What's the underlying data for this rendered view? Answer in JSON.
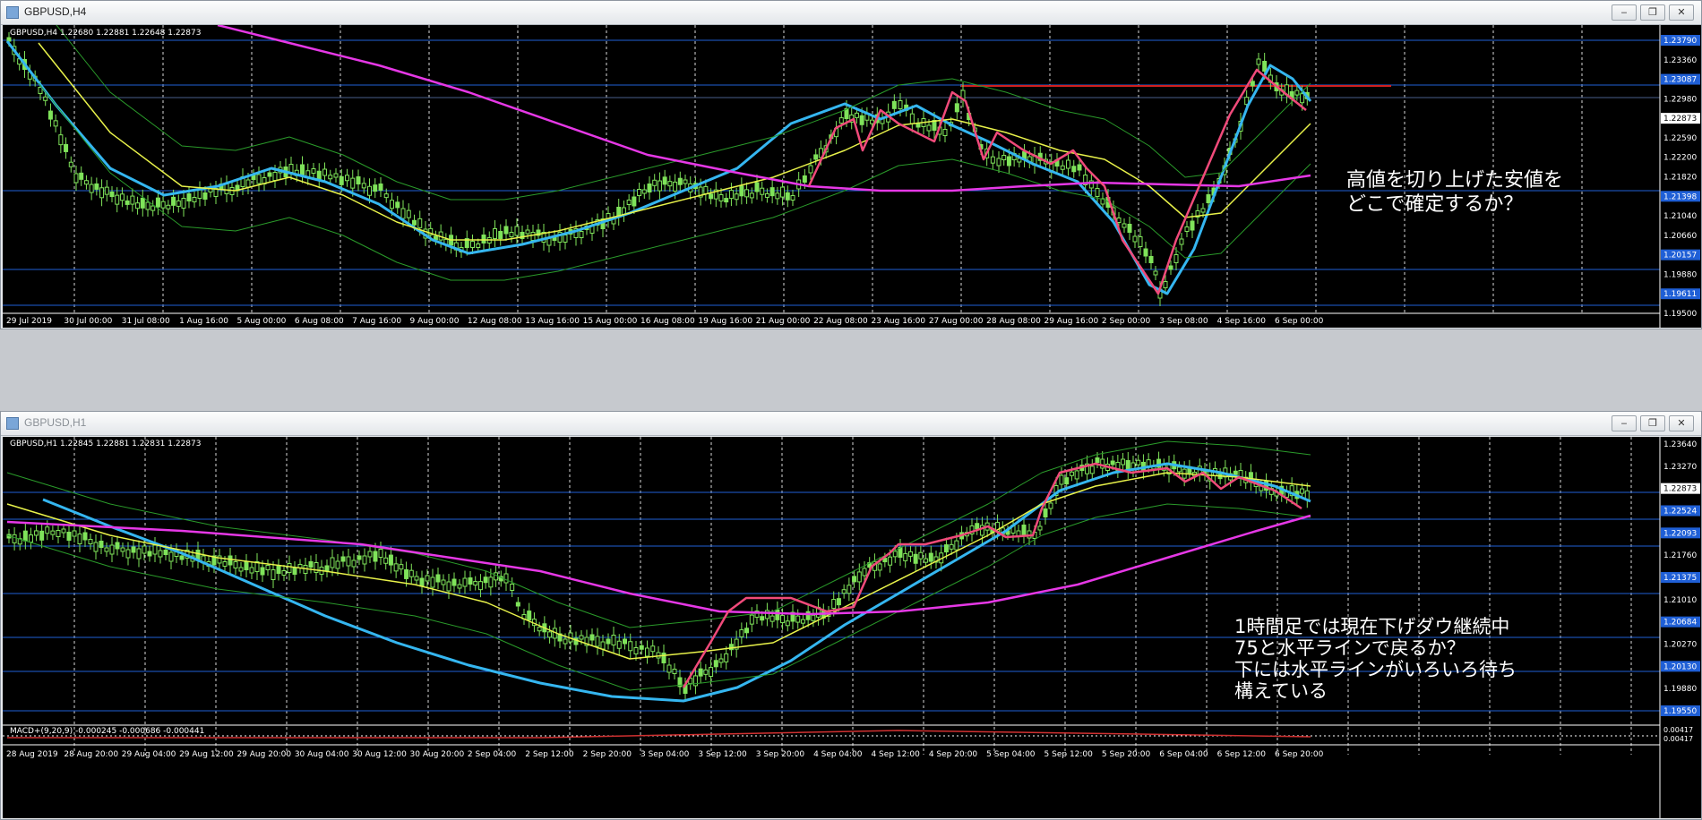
{
  "windows": [
    {
      "title": "GBPUSD,H4",
      "header_text": "GBPUSD,H4  1.22680 1.22881 1.22648 1.22873",
      "price_labels": [
        "1.23790",
        "1.23360",
        "1.23087",
        "1.22980",
        "1.22873",
        "1.22590",
        "1.22200",
        "1.21820",
        "1.21398",
        "1.21040",
        "1.20660",
        "1.20157",
        "1.19880",
        "1.19611",
        "1.19500"
      ],
      "time_labels": [
        "29 Jul 2019",
        "30 Jul 00:00",
        "31 Jul 08:00",
        "1 Aug 16:00",
        "5 Aug 00:00",
        "6 Aug 08:00",
        "7 Aug 16:00",
        "9 Aug 00:00",
        "12 Aug 08:00",
        "13 Aug 16:00",
        "15 Aug 00:00",
        "16 Aug 08:00",
        "19 Aug 16:00",
        "21 Aug 00:00",
        "22 Aug 08:00",
        "23 Aug 16:00",
        "27 Aug 00:00",
        "28 Aug 08:00",
        "29 Aug 16:00",
        "2 Sep 00:00",
        "3 Sep 08:00",
        "4 Sep 16:00",
        "6 Sep 00:00"
      ],
      "annotation": "高値を切り上げた安値を\nどこで確定するか？"
    },
    {
      "title": "GBPUSD,H1",
      "header_text": "GBPUSD,H1  1.22845 1.22881 1.22831 1.22873",
      "price_labels": [
        "1.23640",
        "1.23270",
        "1.22873",
        "1.22524",
        "1.22093",
        "1.21760",
        "1.21375",
        "1.21010",
        "1.20684",
        "1.20270",
        "1.20130",
        "1.19880",
        "1.19550"
      ],
      "time_labels": [
        "28 Aug 2019",
        "28 Aug 20:00",
        "29 Aug 04:00",
        "29 Aug 12:00",
        "29 Aug 20:00",
        "30 Aug 04:00",
        "30 Aug 12:00",
        "30 Aug 20:00",
        "2 Sep 04:00",
        "2 Sep 12:00",
        "2 Sep 20:00",
        "3 Sep 04:00",
        "3 Sep 12:00",
        "3 Sep 20:00",
        "4 Sep 04:00",
        "4 Sep 12:00",
        "4 Sep 20:00",
        "5 Sep 04:00",
        "5 Sep 12:00",
        "5 Sep 20:00",
        "6 Sep 04:00",
        "6 Sep 12:00",
        "6 Sep 20:00"
      ],
      "macd_text": "MACD+(9,20,9) -0.000245 -0.000686 -0.000441",
      "macd_labels": [
        "0.00417",
        "0.00417"
      ],
      "annotation": "1時間足では現在下げダウ継続中\n75と水平ラインで戻るか？\n下には水平ラインがいろいろ待ち\n構えている"
    }
  ],
  "colors": {
    "background": "#000000",
    "grid": "#ffffff",
    "horizontal_line": "#1f5fd6",
    "candle": "#7fe35a",
    "ema_fast": "#35b6f0",
    "ema_mid": "#e8f24a",
    "ema_slow": "#e638e6",
    "zigzag": "#f04a7a",
    "resistance": "#d02020",
    "price_label_bg": "#1f5fd6",
    "current_price_bg": "#ffffff"
  },
  "icons": [
    "window-icon",
    "minimize-icon",
    "restore-icon",
    "close-icon"
  ]
}
